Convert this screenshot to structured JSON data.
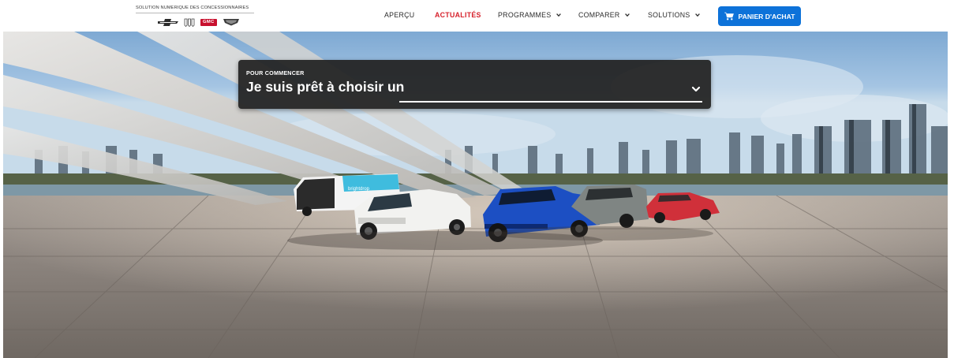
{
  "brand": {
    "tagline": "SOLUTION NUMERIQUE DES CONCESSIONNAIRES",
    "logos": [
      "chevrolet-logo",
      "buick-logo",
      "gmc-logo",
      "cadillac-logo"
    ],
    "gmc_text": "GMC"
  },
  "nav": {
    "items": [
      {
        "label": "APERÇU",
        "active": false,
        "dropdown": false
      },
      {
        "label": "ACTUALITÉS",
        "active": true,
        "dropdown": false
      },
      {
        "label": "PROGRAMMES",
        "active": false,
        "dropdown": true
      },
      {
        "label": "COMPARER",
        "active": false,
        "dropdown": true
      },
      {
        "label": "SOLUTIONS",
        "active": false,
        "dropdown": true
      }
    ],
    "cart": {
      "label": "PANIER D'ACHAT",
      "icon": "shopping-cart-icon"
    }
  },
  "hero": {
    "van_brand": "brightdrop",
    "selector": {
      "eyebrow": "POUR COMMENCER",
      "title": "Je suis prêt à choisir un",
      "value": "",
      "icon": "chevron-down-icon"
    }
  },
  "colors": {
    "accent_red": "#d6202b",
    "cart_blue": "#0d72d9",
    "panel_bg": "#232323"
  }
}
